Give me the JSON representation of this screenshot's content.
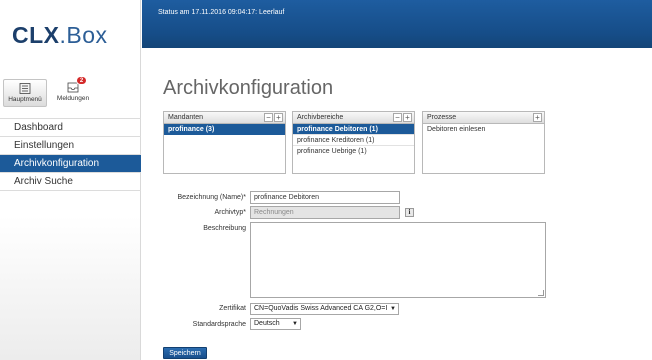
{
  "logo": {
    "strong": "CLX",
    "light": ".Box"
  },
  "modules": {
    "main_label": "Hauptmenü",
    "messages_label": "Meldungen",
    "messages_badge": "2"
  },
  "nav": {
    "items": [
      {
        "label": "Dashboard",
        "active": false
      },
      {
        "label": "Einstellungen",
        "active": false
      },
      {
        "label": "Archivkonfiguration",
        "active": true
      },
      {
        "label": "Archiv Suche",
        "active": false
      }
    ]
  },
  "header": {
    "status": "Status am 17.11.2016 09:04:17: Leerlauf"
  },
  "page": {
    "title": "Archivkonfiguration"
  },
  "panels": {
    "mandanten": {
      "title": "Mandanten",
      "rows": [
        "profinance (3)"
      ]
    },
    "archivbereiche": {
      "title": "Archivbereiche",
      "rows": [
        "profinance Debitoren (1)",
        "profinance Kreditoren (1)",
        "profinance Uebrige (1)"
      ]
    },
    "prozesse": {
      "title": "Prozesse",
      "rows": [
        "Debitoren einlesen"
      ]
    }
  },
  "form": {
    "name_label": "Bezeichnung (Name)",
    "name_value": "profinance Debitoren",
    "type_label": "Archivtyp",
    "type_value": "Rechnungen",
    "desc_label": "Beschreibung",
    "desc_value": "",
    "cert_label": "Zertifikat",
    "cert_value": "CN=QuoVadis Swiss Advanced CA G2,O=I",
    "lang_label": "Standardsprache",
    "lang_value": "Deutsch",
    "required_mark": "*",
    "info_icon_label": "i"
  },
  "actions": {
    "save_label": "Speichern"
  },
  "colors": {
    "accent": "#1c5a99",
    "header": "#164d88"
  }
}
